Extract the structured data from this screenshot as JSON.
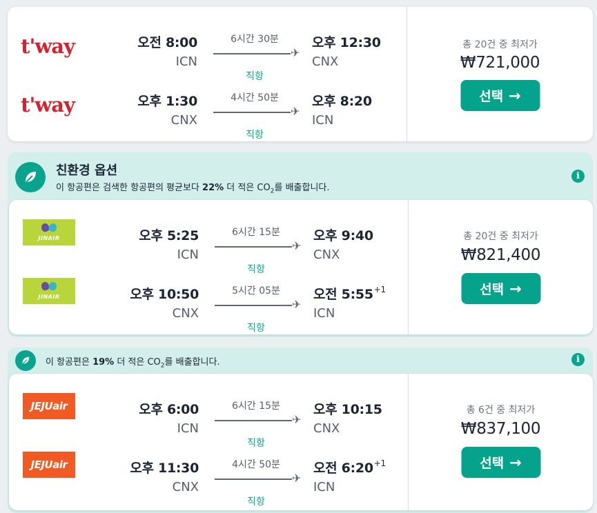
{
  "currency_symbol": "₩",
  "colors": {
    "accent": "#05a38c",
    "eco_bg": "#d3efeb",
    "tway": "#d4232f",
    "jinair": "#b8d63a",
    "jejuair": "#f15a22"
  },
  "icons": {
    "plane": "airplane-icon",
    "leaf": "leaf-icon",
    "info": "info-icon",
    "arrow": "arrow-right-icon"
  },
  "results": [
    {
      "eco": null,
      "price_label": "총 20건 중 최저가",
      "price": "₩721,000",
      "select_label": "선택",
      "legs": [
        {
          "airline": "t'way",
          "logo_text": "t'way",
          "dep_time": "오전 8:00",
          "dep_code": "ICN",
          "duration": "6시간 30분",
          "stops": "직항",
          "arr_time": "오후 12:30",
          "arr_offset": "",
          "arr_code": "CNX"
        },
        {
          "airline": "t'way",
          "logo_text": "t'way",
          "dep_time": "오후 1:30",
          "dep_code": "CNX",
          "duration": "4시간 50분",
          "stops": "직항",
          "arr_time": "오후 8:20",
          "arr_offset": "",
          "arr_code": "ICN"
        }
      ]
    },
    {
      "eco": {
        "title": "친환경 옵션",
        "text_before": "이 항공편은 검색한 항공편의 평균보다 ",
        "percent": "22%",
        "text_middle": " 더 적은 CO",
        "co2_sub": "2",
        "text_after": "를 배출합니다."
      },
      "price_label": "총 20건 중 최저가",
      "price": "₩821,400",
      "select_label": "선택",
      "legs": [
        {
          "airline": "Jin Air",
          "logo_text": "JINAIR",
          "dep_time": "오후 5:25",
          "dep_code": "ICN",
          "duration": "6시간 15분",
          "stops": "직항",
          "arr_time": "오후 9:40",
          "arr_offset": "",
          "arr_code": "CNX"
        },
        {
          "airline": "Jin Air",
          "logo_text": "JINAIR",
          "dep_time": "오후 10:50",
          "dep_code": "CNX",
          "duration": "5시간 05분",
          "stops": "직항",
          "arr_time": "오전 5:55",
          "arr_offset": "+1",
          "arr_code": "ICN"
        }
      ]
    },
    {
      "eco": {
        "title": "",
        "text_before": "이 항공편은 ",
        "percent": "19%",
        "text_middle": " 더 적은 CO",
        "co2_sub": "2",
        "text_after": "를 배출합니다."
      },
      "price_label": "총 6건 중 최저가",
      "price": "₩837,100",
      "select_label": "선택",
      "legs": [
        {
          "airline": "Jeju Air",
          "logo_text": "JEJUair",
          "dep_time": "오후 6:00",
          "dep_code": "ICN",
          "duration": "6시간 15분",
          "stops": "직항",
          "arr_time": "오후 10:15",
          "arr_offset": "",
          "arr_code": "CNX"
        },
        {
          "airline": "Jeju Air",
          "logo_text": "JEJUair",
          "dep_time": "오후 11:30",
          "dep_code": "CNX",
          "duration": "4시간 50분",
          "stops": "직항",
          "arr_time": "오전 6:20",
          "arr_offset": "+1",
          "arr_code": "ICN"
        }
      ]
    }
  ]
}
